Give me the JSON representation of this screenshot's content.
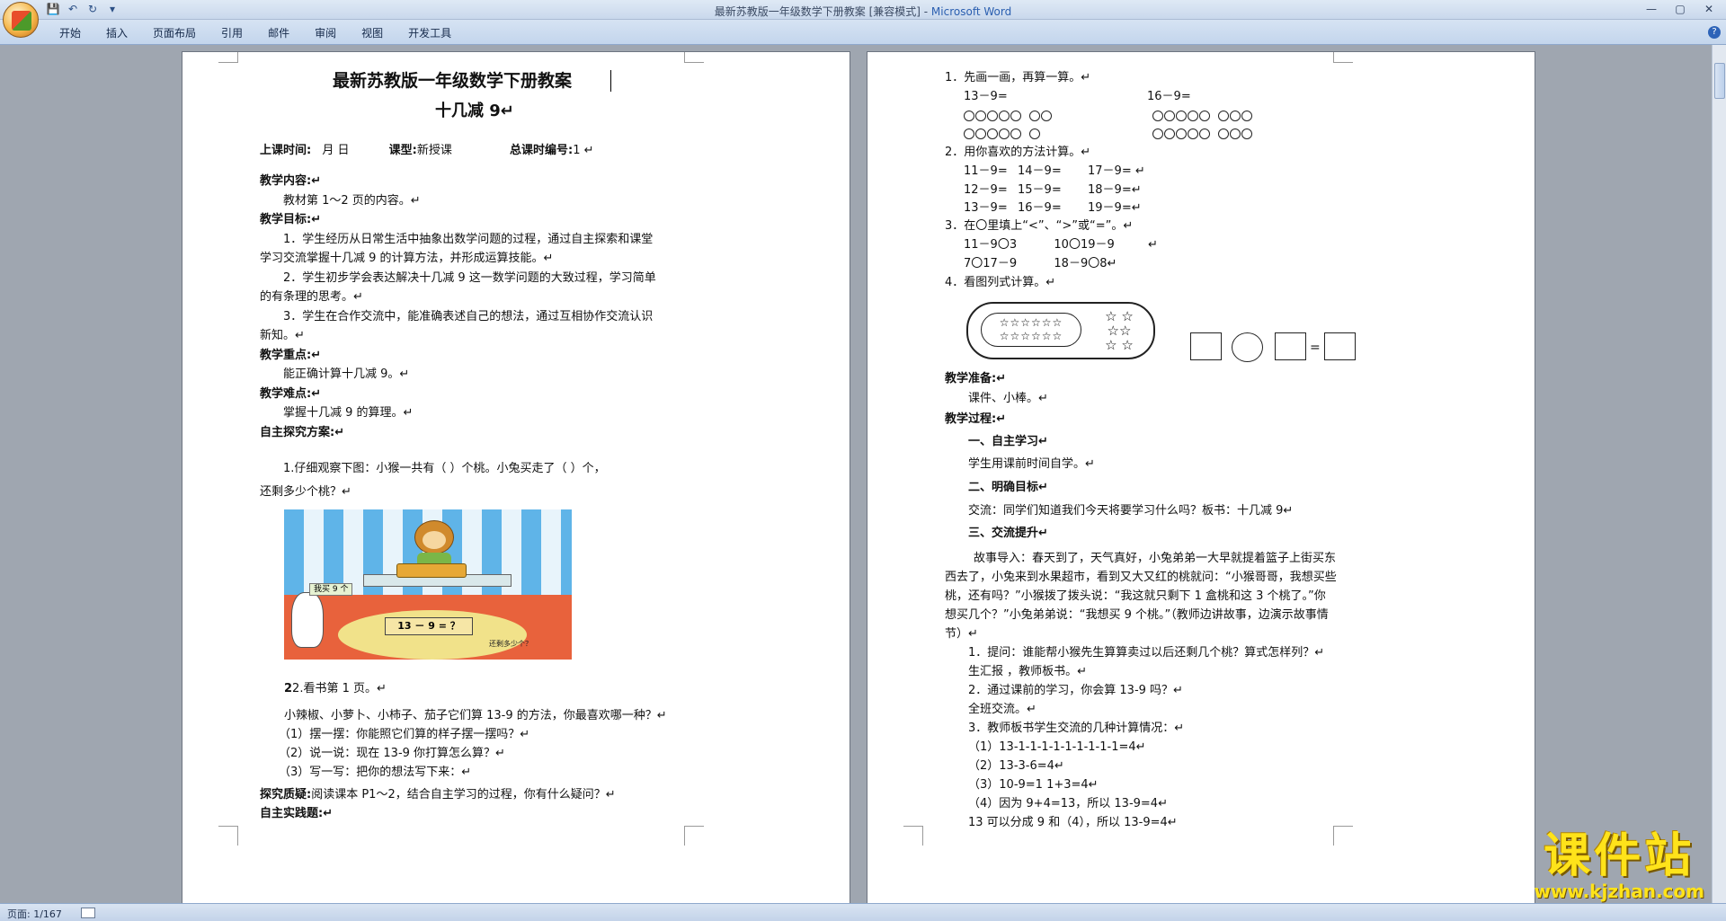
{
  "window": {
    "title_doc": "最新苏教版一年级数学下册教案 [兼容模式] - ",
    "title_app": "Microsoft Word",
    "minimize": "—",
    "maximize": "▢",
    "close": "✕"
  },
  "qat": {
    "save": "💾",
    "undo": "↶",
    "redo": "↻",
    "more": "▾"
  },
  "ribbon_tabs": [
    "开始",
    "插入",
    "页面布局",
    "引用",
    "邮件",
    "审阅",
    "视图",
    "开发工具"
  ],
  "help": "?",
  "status": {
    "page_info": "页面: 1/167"
  },
  "watermark": {
    "text": "课件站",
    "url": "www.kjzhan.com"
  },
  "page1": {
    "title": "最新苏教版一年级数学下册教案",
    "subtitle": "十几减 9↵",
    "meta": {
      "time_label": "上课时间:",
      "time_value": "月   日",
      "type_label": "课型:",
      "type_value": "新授课",
      "num_label": "总课时编号:",
      "num_value": "1   ↵"
    },
    "lines": [
      {
        "t": "教学内容:↵",
        "bold": true,
        "x": 0
      },
      {
        "t": "教材第 1～2 页的内容。↵",
        "bold": false,
        "x": 26
      },
      {
        "t": "教学目标:↵",
        "bold": true,
        "x": 0
      },
      {
        "t": "1．学生经历从日常生活中抽象出数学问题的过程，通过自主探索和课堂",
        "bold": false,
        "x": 26
      },
      {
        "t": "学习交流掌握十几减 9 的计算方法，并形成运算技能。↵",
        "bold": false,
        "x": 0
      },
      {
        "t": "2．学生初步学会表达解决十几减 9 这一数学问题的大致过程，学习简单",
        "bold": false,
        "x": 26
      },
      {
        "t": "的有条理的思考。↵",
        "bold": false,
        "x": 0
      },
      {
        "t": "3．学生在合作交流中，能准确表述自己的想法，通过互相协作交流认识",
        "bold": false,
        "x": 26
      },
      {
        "t": "新知。↵",
        "bold": false,
        "x": 0
      },
      {
        "t": "教学重点:↵",
        "bold": true,
        "x": 0
      },
      {
        "t": "能正确计算十几减 9。↵",
        "bold": false,
        "x": 26
      },
      {
        "t": "教学难点:↵",
        "bold": true,
        "x": 0
      },
      {
        "t": "掌握十几减 9 的算理。↵",
        "bold": false,
        "x": 26
      },
      {
        "t": "自主探究方案:↵",
        "bold": true,
        "x": 0
      }
    ],
    "q1a": "1.仔细观察下图：小猴一共有（     ）个桃。小兔买走了（     ）个，",
    "q1b": "还剩多少个桃？↵",
    "pic_label_buy": "我买 9 个",
    "pic_label_eq": "13 － 9 = ？",
    "pic_label_left": "还剩多少个？",
    "q2": "2.看书第 1 页。↵",
    "lines2": [
      "小辣椒、小萝卜、小柿子、茄子它们算 13-9 的方法，你最喜欢哪一种？↵",
      "（1）摆一摆：你能照它们算的样子摆一摆吗？↵",
      "（2）说一说：现在 13-9 你打算怎么算？↵",
      "（3）写一写：把你的想法写下来：↵"
    ],
    "inquiry_label": "探究质疑:",
    "inquiry_text": "阅读课本 P1～2，结合自主学习的过程，你有什么疑问？↵",
    "practice": "自主实践题:↵"
  },
  "page2": {
    "q1": "1．先画一画，再算一算。↵",
    "q1_eq1": "13－9=",
    "q1_eq2": "16－9=",
    "q2": "2．用你喜欢的方法计算。↵",
    "calc_rows": [
      [
        "11－9=",
        "14－9=",
        "17－9=  ↵"
      ],
      [
        "12－9=",
        "15－9=",
        "18－9=↵"
      ],
      [
        "13－9=",
        "16－9=",
        "19－9=↵"
      ]
    ],
    "q3": "3．在〇里填上“<”、“>”或“=”。↵",
    "cmp1": "11－9〇3          10〇19－9         ↵",
    "cmp2": "7〇17－9          18－9〇8↵",
    "q4": "4．看图列式计算。↵",
    "equals": "=",
    "prep_label": "教学准备:↵",
    "prep_text": "课件、小棒。↵",
    "process_label": "教学过程:↵",
    "s1": "一、自主学习↵",
    "s1_text": "学生用课前时间自学。↵",
    "s2": "二、明确目标↵",
    "s2_text": "交流：同学们知道我们今天将要学习什么吗？板书：十几减 9↵",
    "s3": "三、交流提升↵",
    "story": [
      "故事导入：春天到了，天气真好，小兔弟弟一大早就提着篮子上街买东",
      "西去了，小兔来到水果超市，看到又大又红的桃就问：“小猴哥哥，我想买些",
      "桃，还有吗？”小猴拨了拨头说：“我这就只剩下 1 盒桃和这 3 个桃了。”你",
      "想买几个？”小兔弟弟说：“我想买 9 个桃。”（教师边讲故事，边演示故事情",
      "节）↵"
    ],
    "steps": [
      "1．提问：谁能帮小猴先生算算卖过以后还剩几个桃？算式怎样列？↵",
      "生汇报 ，教师板书。↵",
      "2．通过课前的学习，你会算 13-9 吗？↵",
      "全班交流。↵",
      "3．教师板书学生交流的几种计算情况：↵",
      "（1）13-1-1-1-1-1-1-1-1-1=4↵",
      "（2）13-3-6=4↵",
      "（3）10-9=1      1+3=4↵",
      "（4）因为 9+4=13，所以 13-9=4↵",
      "13 可以分成 9 和（4），所以 13-9=4↵"
    ]
  }
}
